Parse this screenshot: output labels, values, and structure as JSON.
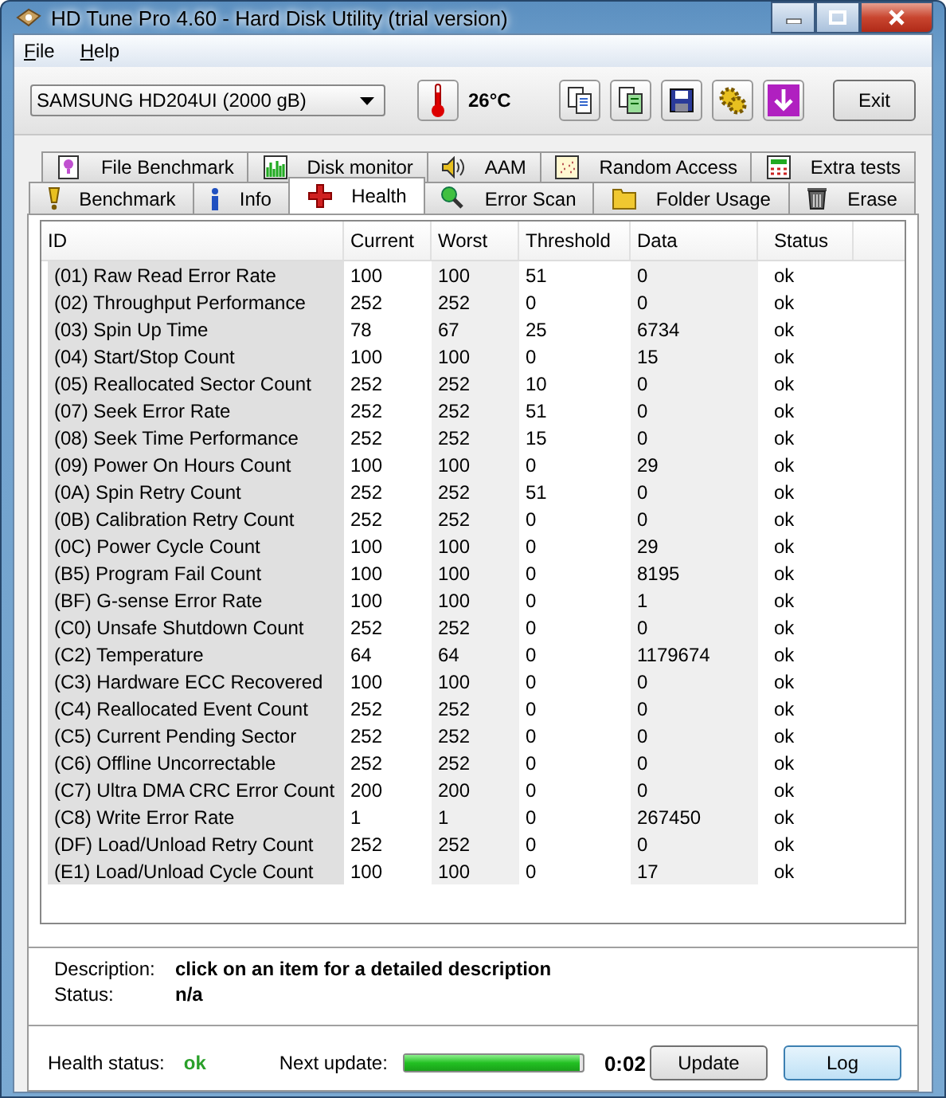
{
  "window": {
    "title": "HD Tune Pro 4.60 - Hard Disk Utility (trial version)"
  },
  "menu": [
    "File",
    "Help"
  ],
  "toolbar": {
    "drive": "SAMSUNG HD204UI (2000 gB)",
    "temperature": "26°C",
    "exit": "Exit"
  },
  "tabs_back": [
    {
      "label": "File Benchmark",
      "selected": false
    },
    {
      "label": "Disk monitor",
      "selected": false
    },
    {
      "label": "AAM",
      "selected": false
    },
    {
      "label": "Random Access",
      "selected": false
    },
    {
      "label": "Extra tests",
      "selected": false
    }
  ],
  "tabs_front": [
    {
      "label": "Benchmark",
      "selected": false
    },
    {
      "label": "Info",
      "selected": false
    },
    {
      "label": "Health",
      "selected": true
    },
    {
      "label": "Error Scan",
      "selected": false
    },
    {
      "label": "Folder Usage",
      "selected": false
    },
    {
      "label": "Erase",
      "selected": false
    }
  ],
  "table": {
    "columns": [
      "ID",
      "Current",
      "Worst",
      "Threshold",
      "Data",
      "Status"
    ],
    "rows": [
      [
        "(01) Raw Read Error Rate",
        "100",
        "100",
        "51",
        "0",
        "ok"
      ],
      [
        "(02) Throughput Performance",
        "252",
        "252",
        "0",
        "0",
        "ok"
      ],
      [
        "(03) Spin Up Time",
        "78",
        "67",
        "25",
        "6734",
        "ok"
      ],
      [
        "(04) Start/Stop Count",
        "100",
        "100",
        "0",
        "15",
        "ok"
      ],
      [
        "(05) Reallocated Sector Count",
        "252",
        "252",
        "10",
        "0",
        "ok"
      ],
      [
        "(07) Seek Error Rate",
        "252",
        "252",
        "51",
        "0",
        "ok"
      ],
      [
        "(08) Seek Time Performance",
        "252",
        "252",
        "15",
        "0",
        "ok"
      ],
      [
        "(09) Power On Hours Count",
        "100",
        "100",
        "0",
        "29",
        "ok"
      ],
      [
        "(0A) Spin Retry Count",
        "252",
        "252",
        "51",
        "0",
        "ok"
      ],
      [
        "(0B) Calibration Retry Count",
        "252",
        "252",
        "0",
        "0",
        "ok"
      ],
      [
        "(0C) Power Cycle Count",
        "100",
        "100",
        "0",
        "29",
        "ok"
      ],
      [
        "(B5) Program Fail Count",
        "100",
        "100",
        "0",
        "8195",
        "ok"
      ],
      [
        "(BF) G-sense Error Rate",
        "100",
        "100",
        "0",
        "1",
        "ok"
      ],
      [
        "(C0) Unsafe Shutdown Count",
        "252",
        "252",
        "0",
        "0",
        "ok"
      ],
      [
        "(C2) Temperature",
        "64",
        "64",
        "0",
        "1179674",
        "ok"
      ],
      [
        "(C3) Hardware ECC Recovered",
        "100",
        "100",
        "0",
        "0",
        "ok"
      ],
      [
        "(C4) Reallocated Event Count",
        "252",
        "252",
        "0",
        "0",
        "ok"
      ],
      [
        "(C5) Current Pending Sector",
        "252",
        "252",
        "0",
        "0",
        "ok"
      ],
      [
        "(C6) Offline Uncorrectable",
        "252",
        "252",
        "0",
        "0",
        "ok"
      ],
      [
        "(C7) Ultra DMA CRC Error Count",
        "200",
        "200",
        "0",
        "0",
        "ok"
      ],
      [
        "(C8) Write Error Rate",
        "1",
        "1",
        "0",
        "267450",
        "ok"
      ],
      [
        "(DF) Load/Unload Retry Count",
        "252",
        "252",
        "0",
        "0",
        "ok"
      ],
      [
        "(E1) Load/Unload Cycle Count",
        "100",
        "100",
        "0",
        "17",
        "ok"
      ]
    ]
  },
  "details": [
    {
      "label": "Description:",
      "value": "click on an item for a detailed description"
    },
    {
      "label": "Status:",
      "value": "n/a"
    }
  ],
  "footer": {
    "health_label": "Health status:",
    "health": "ok",
    "next_label": "Next update:",
    "level": 0.98,
    "countdown": "0:02",
    "buttons": [
      {
        "label": "Update",
        "selected": false
      },
      {
        "label": "Log",
        "selected": true
      }
    ]
  }
}
